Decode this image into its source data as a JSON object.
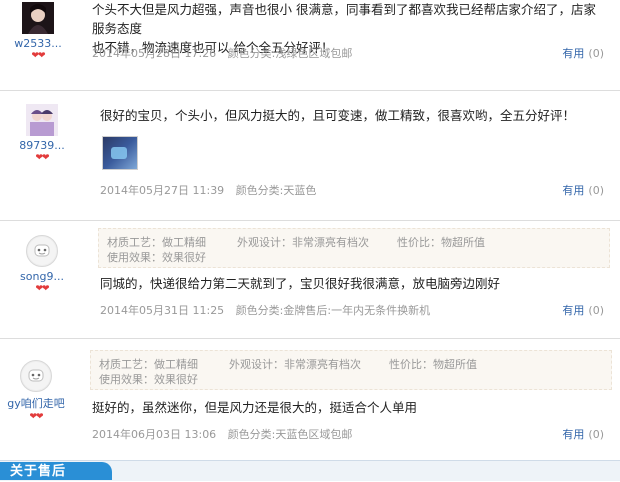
{
  "reviews": [
    {
      "user": "w2533...",
      "hearts": "❤❤",
      "content_line1": "个头不大但是风力超强，声音也很小 很满意，同事看到了都喜欢我已经帮店家介绍了，店家服务态度",
      "content_line2": "也不错，物流速度也可以 给个全五分好评！",
      "date": "2014年05月28日 17:26",
      "color": "颜色分类:浅绿色区域包邮",
      "useful_label": "有用",
      "useful_count": "(0)"
    },
    {
      "user": "89739...",
      "hearts": "❤❤",
      "content_line1": "很好的宝贝，个头小，但风力挺大的，且可变速，做工精致，很喜欢哟，全五分好评！",
      "date": "2014年05月27日 11:39",
      "color": "颜色分类:天蓝色",
      "useful_label": "有用",
      "useful_count": "(0)"
    },
    {
      "user": "song9...",
      "hearts": "❤❤",
      "tags": [
        "材质工艺：做工精细",
        "外观设计：非常漂亮有档次",
        "性价比：物超所值",
        "使用效果：效果很好"
      ],
      "content_line1": "同城的，快递很给力第二天就到了，宝贝很好我很满意，放电脑旁边刚好",
      "date": "2014年05月31日 11:25",
      "color": "颜色分类:金牌售后:一年内无条件换新机",
      "useful_label": "有用",
      "useful_count": "(0)"
    },
    {
      "user": "gy咱们走吧",
      "hearts": "❤❤",
      "tags": [
        "材质工艺：做工精细",
        "外观设计：非常漂亮有档次",
        "性价比：物超所值",
        "使用效果：效果很好"
      ],
      "content_line1": "挺好的，虽然迷你，但是风力还是很大的，挺适合个人单用",
      "date": "2014年06月03日 13:06",
      "color": "颜色分类:天蓝色区域包邮",
      "useful_label": "有用",
      "useful_count": "(0)"
    }
  ],
  "footer": {
    "tab_label": "关于售后"
  }
}
